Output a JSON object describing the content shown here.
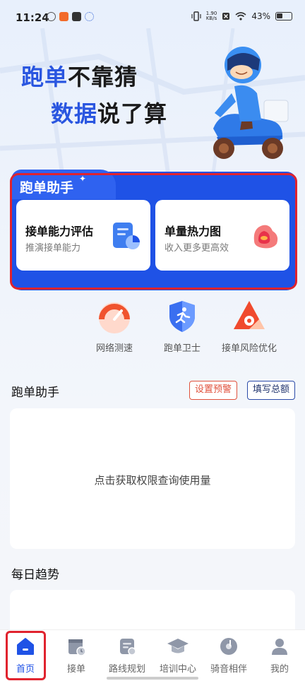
{
  "status_bar": {
    "time": "11:24",
    "net_speed_value": "1.90",
    "net_speed_unit": "KB/s",
    "battery": "43%"
  },
  "hero": {
    "line1_highlight": "跑单",
    "line1_rest": "不靠猜",
    "line2_highlight": "数据",
    "line2_rest": "说了算"
  },
  "assistant": {
    "title": "跑单助手",
    "cards": [
      {
        "title": "接单能力评估",
        "subtitle": "推演接单能力",
        "icon": "clipboard-chart-icon"
      },
      {
        "title": "单量热力图",
        "subtitle": "收入更多更高效",
        "icon": "heatmap-icon"
      }
    ]
  },
  "tools": [
    {
      "label": "网络测速",
      "icon": "speedometer-icon"
    },
    {
      "label": "跑单卫士",
      "icon": "shield-runner-icon"
    },
    {
      "label": "接单风险优化",
      "icon": "warning-triangle-icon"
    }
  ],
  "usage_section": {
    "title": "跑单助手",
    "set_alert_label": "设置预警",
    "fill_total_label": "填写总额",
    "empty_text": "点击获取权限查询使用量"
  },
  "trend_section": {
    "title": "每日趋势"
  },
  "bottom_nav": [
    {
      "label": "首页",
      "icon": "home-icon",
      "active": true
    },
    {
      "label": "接单",
      "icon": "calendar-clock-icon",
      "active": false
    },
    {
      "label": "路线规划",
      "icon": "route-doc-icon",
      "active": false
    },
    {
      "label": "培训中心",
      "icon": "graduation-cap-icon",
      "active": false
    },
    {
      "label": "骑音相伴",
      "icon": "music-disc-icon",
      "active": false
    },
    {
      "label": "我的",
      "icon": "profile-icon",
      "active": false
    }
  ],
  "colors": {
    "accent": "#1f52e6",
    "highlight": "#2a56e0",
    "alert": "#e0513c",
    "selection": "#e0232e"
  }
}
